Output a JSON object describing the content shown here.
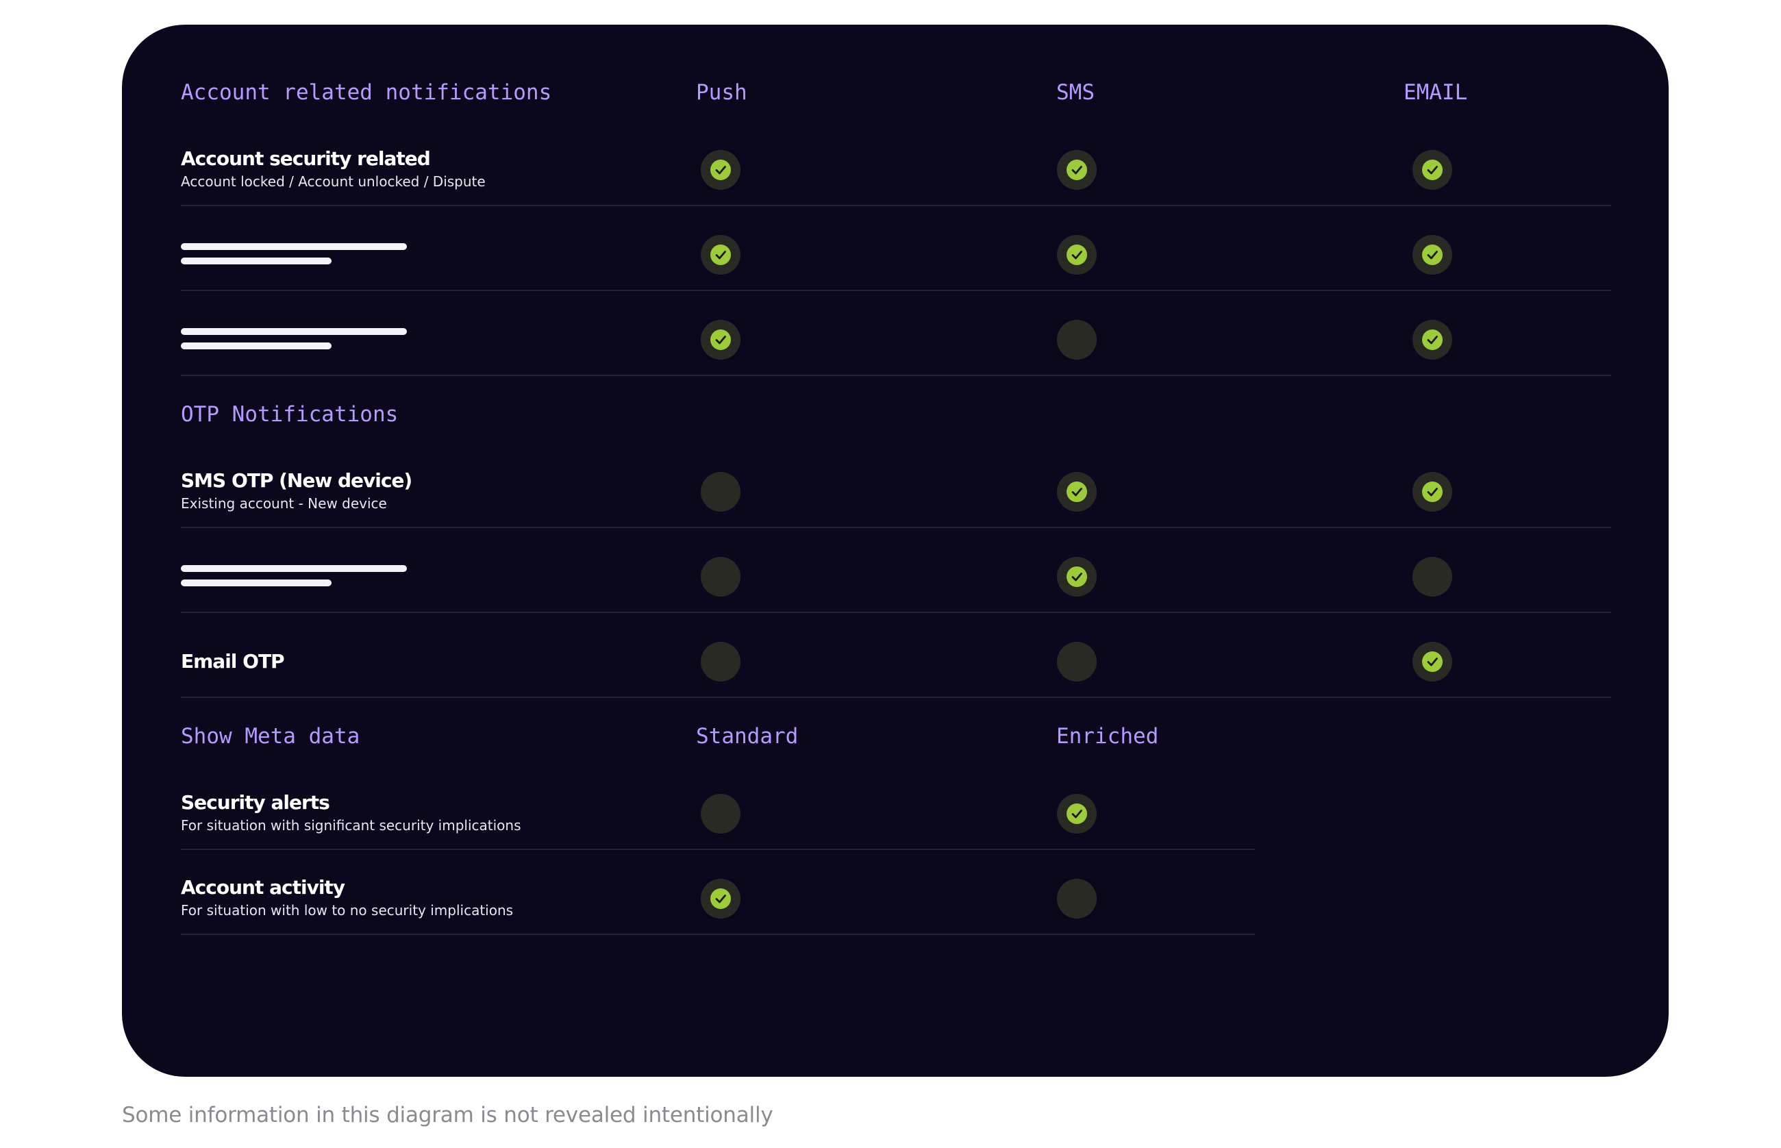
{
  "sections": [
    {
      "header": "Account related notifications",
      "columns": [
        "Push",
        "SMS",
        "EMAIL"
      ],
      "rows": [
        {
          "title": "Account security related",
          "subtitle": "Account locked / Account unlocked / Dispute",
          "checks": [
            true,
            true,
            true
          ]
        },
        {
          "title": "",
          "subtitle": "",
          "redacted": true,
          "checks": [
            true,
            true,
            true
          ]
        },
        {
          "title": "",
          "subtitle": "",
          "redacted": true,
          "checks": [
            true,
            false,
            true
          ]
        }
      ]
    },
    {
      "header": "OTP Notifications",
      "columns": [],
      "rows": [
        {
          "title": "SMS OTP (New device)",
          "subtitle": "Existing account - New device",
          "checks": [
            false,
            true,
            true
          ]
        },
        {
          "title": "",
          "subtitle": "",
          "redacted": true,
          "checks": [
            false,
            true,
            false
          ]
        },
        {
          "title": "Email OTP",
          "subtitle": "",
          "checks": [
            false,
            false,
            true
          ]
        }
      ]
    },
    {
      "header": "Show Meta data",
      "columns": [
        "Standard",
        "Enriched"
      ],
      "rows": [
        {
          "title": "Security alerts",
          "subtitle": "For situation with significant security implications",
          "checks": [
            false,
            true
          ]
        },
        {
          "title": "Account activity",
          "subtitle": "For situation with low to no security implications",
          "checks": [
            true,
            false
          ]
        }
      ]
    }
  ],
  "caption": "Some information in this diagram is not revealed intentionally",
  "colors": {
    "panel": "#0b081d",
    "header": "#b69bff",
    "check_on": "#9dcc3a",
    "check_bg": "#2a2a24"
  },
  "icons": {
    "check_on": "check-circle-icon",
    "check_off": "empty-circle-icon"
  }
}
